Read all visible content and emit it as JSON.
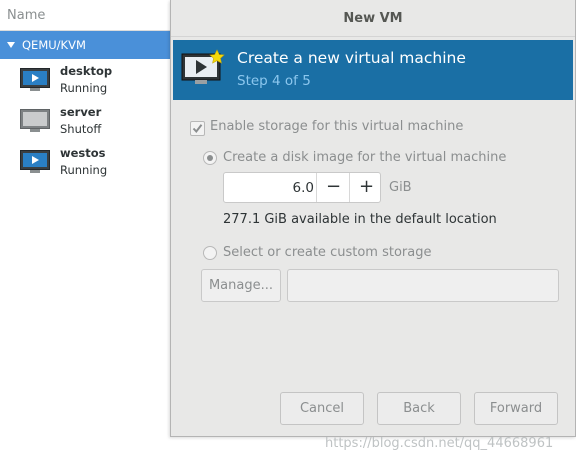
{
  "manager": {
    "header": "Name",
    "connection": "QEMU/KVM",
    "vms": [
      {
        "name": "desktop",
        "state": "Running",
        "icon": "vm-running-icon"
      },
      {
        "name": "server",
        "state": "Shutoff",
        "icon": "vm-shutoff-icon"
      },
      {
        "name": "westos",
        "state": "Running",
        "icon": "vm-running-icon"
      }
    ]
  },
  "dialog": {
    "title": "New VM",
    "banner": {
      "title": "Create a new virtual machine",
      "step": "Step 4 of 5",
      "color": "#1a6fa5"
    },
    "enable_storage_label": "Enable storage for this virtual machine",
    "enable_storage_checked": true,
    "disk_image_label": "Create a disk image for the virtual machine",
    "disk_size": "6.0",
    "disk_minus": "−",
    "disk_plus": "+",
    "disk_unit": "GiB",
    "available": "277.1 GiB available in the default location",
    "custom_storage_label": "Select or create custom storage",
    "manage_label": "Manage...",
    "buttons": {
      "cancel": "Cancel",
      "back": "Back",
      "forward": "Forward"
    }
  },
  "watermark": "https://blog.csdn.net/qq_44668961"
}
